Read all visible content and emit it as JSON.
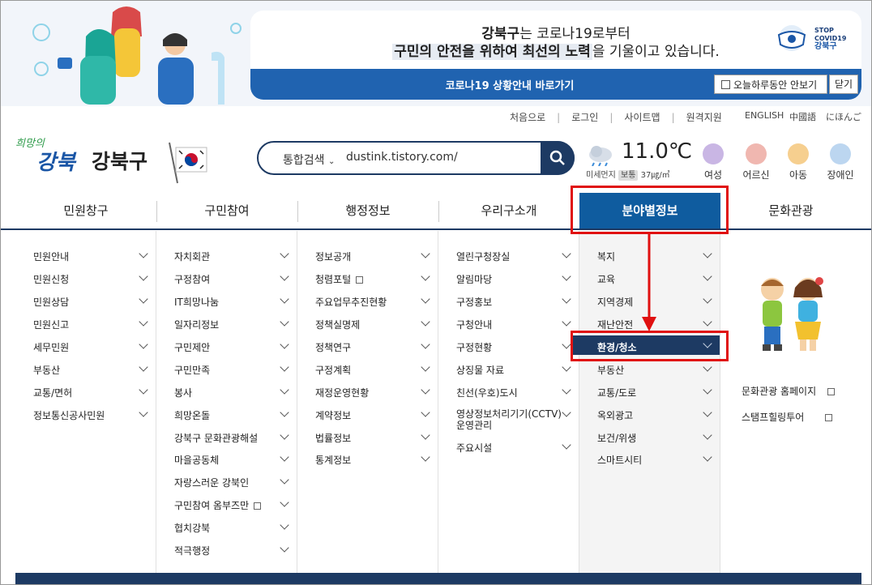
{
  "banner": {
    "line1_brand": "강북구",
    "line1_rest": "는 코로나19로부터",
    "line2_hl": "구민의 안전을 위하여 최선의 노력",
    "line2_rest": "을 기울이고 있습니다.",
    "stop_logo": {
      "l1": "STOP",
      "l2": "COVID19",
      "l3": "강북구"
    },
    "bar_link": "코로나19 상황안내 바로가기",
    "today_label": "오늘하루동안 안보기",
    "close_label": "닫기"
  },
  "util": {
    "links": [
      "처음으로",
      "로그인",
      "사이트맵",
      "원격지원"
    ],
    "langs": [
      "ENGLISH",
      "中國語",
      "にほんご"
    ]
  },
  "header": {
    "logo_script": "희망의",
    "logo_brand": "강북",
    "logo_text": "강북구",
    "search_category": "통합검색",
    "search_value": "dustink.tistory.com/",
    "weather_temp": "11.0℃",
    "dust_label": "미세먼지",
    "dust_level": "보통",
    "dust_value": "37㎍/㎥",
    "persons": [
      "여성",
      "어르신",
      "아동",
      "장애인"
    ]
  },
  "gnb": [
    "민원창구",
    "구민참여",
    "행정정보",
    "우리구소개",
    "분야별정보",
    "문화관광"
  ],
  "menus": {
    "col1": [
      "민원안내",
      "민원신청",
      "민원상담",
      "민원신고",
      "세무민원",
      "부동산",
      "교통/면허",
      "정보통신공사민원"
    ],
    "col2": [
      "자치회관",
      "구정참여",
      "IT희망나눔",
      "일자리정보",
      "구민제안",
      "구민만족",
      "봉사",
      "희망온돌",
      "강북구 문화관광해설",
      "마을공동체",
      "자랑스러운 강북인",
      "구민참여 옴부즈만",
      "협치강북",
      "적극행정"
    ],
    "col3": [
      "정보공개",
      "청렴포털",
      "주요업무추진현황",
      "정책실명제",
      "정책연구",
      "구정계획",
      "재정운영현황",
      "계약정보",
      "법률정보",
      "통계정보"
    ],
    "col4": [
      "열린구청장실",
      "알림마당",
      "구정홍보",
      "구청안내",
      "구정현황",
      "상징물 자료",
      "친선(우호)도시",
      "영상정보처리기기(CCTV)",
      "운영관리",
      "주요시설"
    ],
    "col5": [
      "복지",
      "교육",
      "지역경제",
      "재난안전",
      "환경/청소",
      "부동산",
      "교통/도로",
      "옥외광고",
      "보건/위생",
      "스마트시티"
    ],
    "col6": [
      "문화관광 홈페이지",
      "스탬프힐링투어"
    ]
  },
  "colors": {
    "navy": "#1d3a63",
    "active_blue": "#0f5c9f",
    "annotation_red": "#e01010",
    "banner_bar": "#2063b0"
  }
}
